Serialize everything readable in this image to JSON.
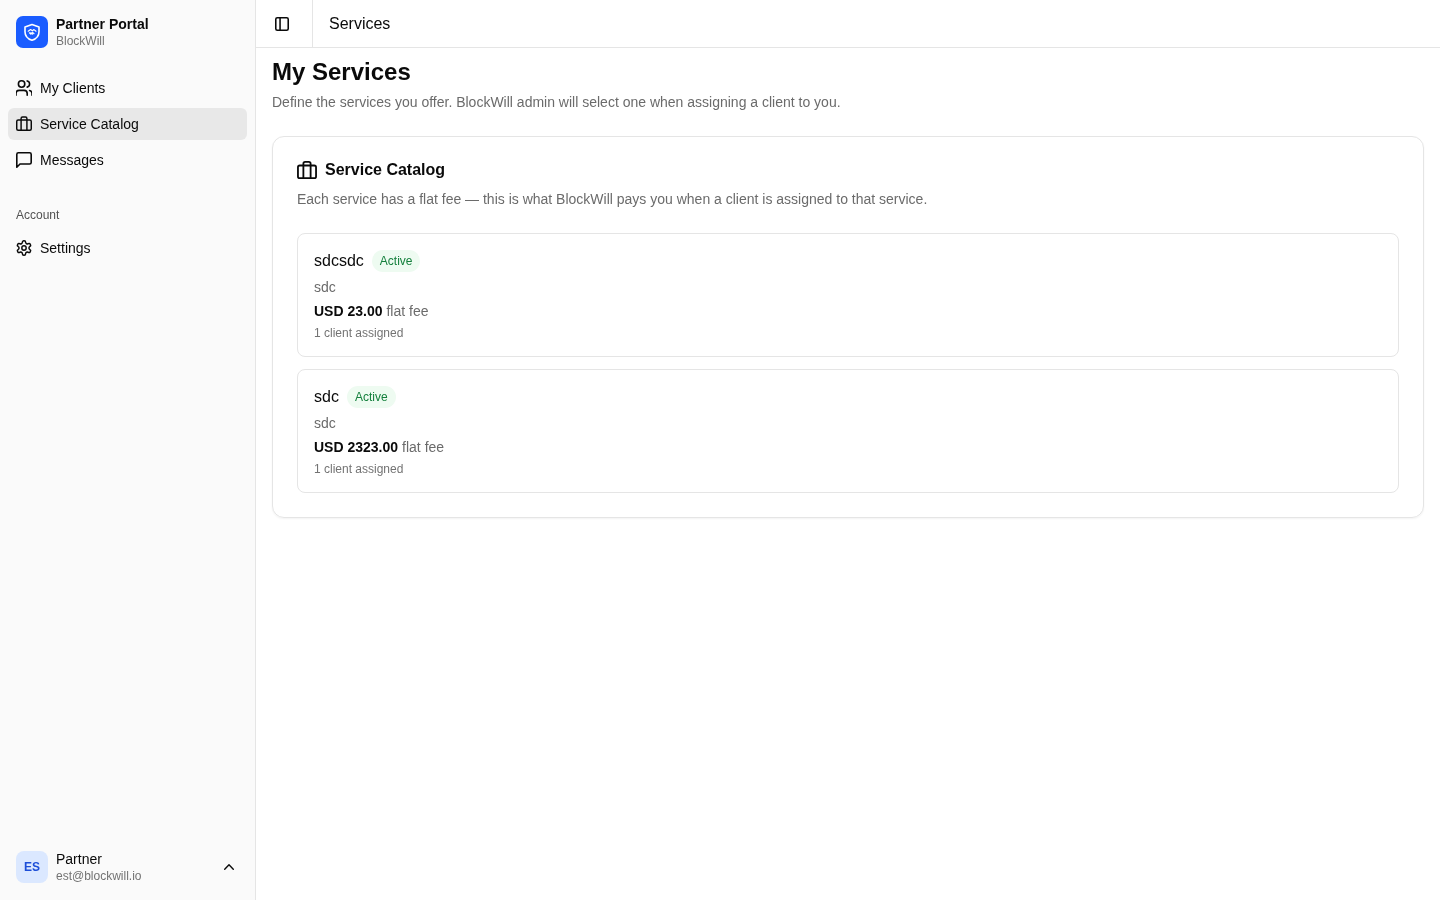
{
  "sidebar": {
    "brand": {
      "title": "Partner Portal",
      "subtitle": "BlockWill"
    },
    "sections": [
      {
        "items": [
          {
            "label": "My Clients",
            "selected": false
          },
          {
            "label": "Service Catalog",
            "selected": true
          },
          {
            "label": "Messages",
            "selected": false
          }
        ]
      },
      {
        "label": "Account",
        "items": [
          {
            "label": "Settings",
            "selected": false
          }
        ]
      }
    ],
    "user": {
      "initials": "ES",
      "name": "Partner",
      "email": "est@blockwill.io"
    }
  },
  "header": {
    "title": "Services"
  },
  "page": {
    "title": "My Services",
    "subtitle": "Define the services you offer. BlockWill admin will select one when assigning a client to you."
  },
  "catalog": {
    "title": "Service Catalog",
    "description": "Each service has a flat fee — this is what BlockWill pays you when a client is assigned to that service.",
    "services": [
      {
        "name": "sdcsdc",
        "status": "Active",
        "description": "sdc",
        "fee": "USD 23.00",
        "fee_label": "flat fee",
        "clients": "1 client assigned"
      },
      {
        "name": "sdc",
        "status": "Active",
        "description": "sdc",
        "fee": "USD 2323.00",
        "fee_label": "flat fee",
        "clients": "1 client assigned"
      }
    ]
  }
}
